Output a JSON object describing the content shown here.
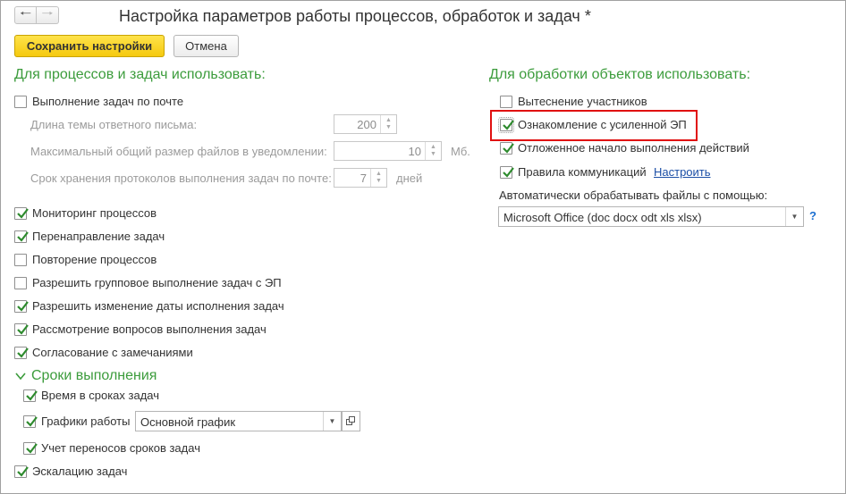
{
  "window": {
    "title": "Настройка параметров работы процессов, обработок и задач *"
  },
  "toolbar": {
    "back_icon": "arrow-left-icon",
    "forward_icon": "arrow-right-icon",
    "save_label": "Сохранить настройки",
    "cancel_label": "Отмена"
  },
  "colors": {
    "accent_section": "#3c9c3c",
    "primary_button": "#f5c90f",
    "highlight_border": "#e01010",
    "link": "#1c4fa6"
  },
  "left": {
    "header": "Для процессов и задач использовать:",
    "mail_tasks": {
      "label": "Выполнение задач по почте",
      "checked": false
    },
    "reply_subject": {
      "label": "Длина темы ответного письма:",
      "value": "200"
    },
    "max_files": {
      "label": "Максимальный общий размер файлов в уведомлении:",
      "value": "10",
      "unit": "Мб."
    },
    "log_retention": {
      "label": "Срок хранения протоколов выполнения задач по почте:",
      "value": "7",
      "unit": "дней"
    },
    "options": [
      {
        "label": "Мониторинг процессов",
        "checked": true
      },
      {
        "label": "Перенаправление задач",
        "checked": true
      },
      {
        "label": "Повторение процессов",
        "checked": false
      },
      {
        "label": "Разрешить групповое выполнение задач с ЭП",
        "checked": false
      },
      {
        "label": "Разрешить изменение даты исполнения задач",
        "checked": true
      },
      {
        "label": "Рассмотрение вопросов выполнения задач",
        "checked": true
      },
      {
        "label": "Согласование с замечаниями",
        "checked": true
      }
    ],
    "deadlines": {
      "header": "Сроки выполнения",
      "time_in_deadlines": {
        "label": "Время в сроках задач",
        "checked": true
      },
      "schedules": {
        "label": "Графики работы",
        "checked": true,
        "value": "Основной график"
      },
      "postponements": {
        "label": "Учет переносов сроков задач",
        "checked": true
      }
    },
    "escalation": {
      "label": "Эскалацию задач",
      "checked": true
    }
  },
  "right": {
    "header": "Для обработки объектов использовать:",
    "options": [
      {
        "label": "Вытеснение участников",
        "checked": false
      },
      {
        "label": "Ознакомление с усиленной ЭП",
        "checked": true
      },
      {
        "label": "Отложенное начало выполнения действий",
        "checked": true
      },
      {
        "label": "Правила коммуникаций",
        "checked": true
      }
    ],
    "configure_link": "Настроить",
    "auto_files_label": "Автоматически обрабатывать файлы с помощью:",
    "auto_files_value": "Microsoft Office (doc docx odt xls xlsx)",
    "help": "?"
  }
}
